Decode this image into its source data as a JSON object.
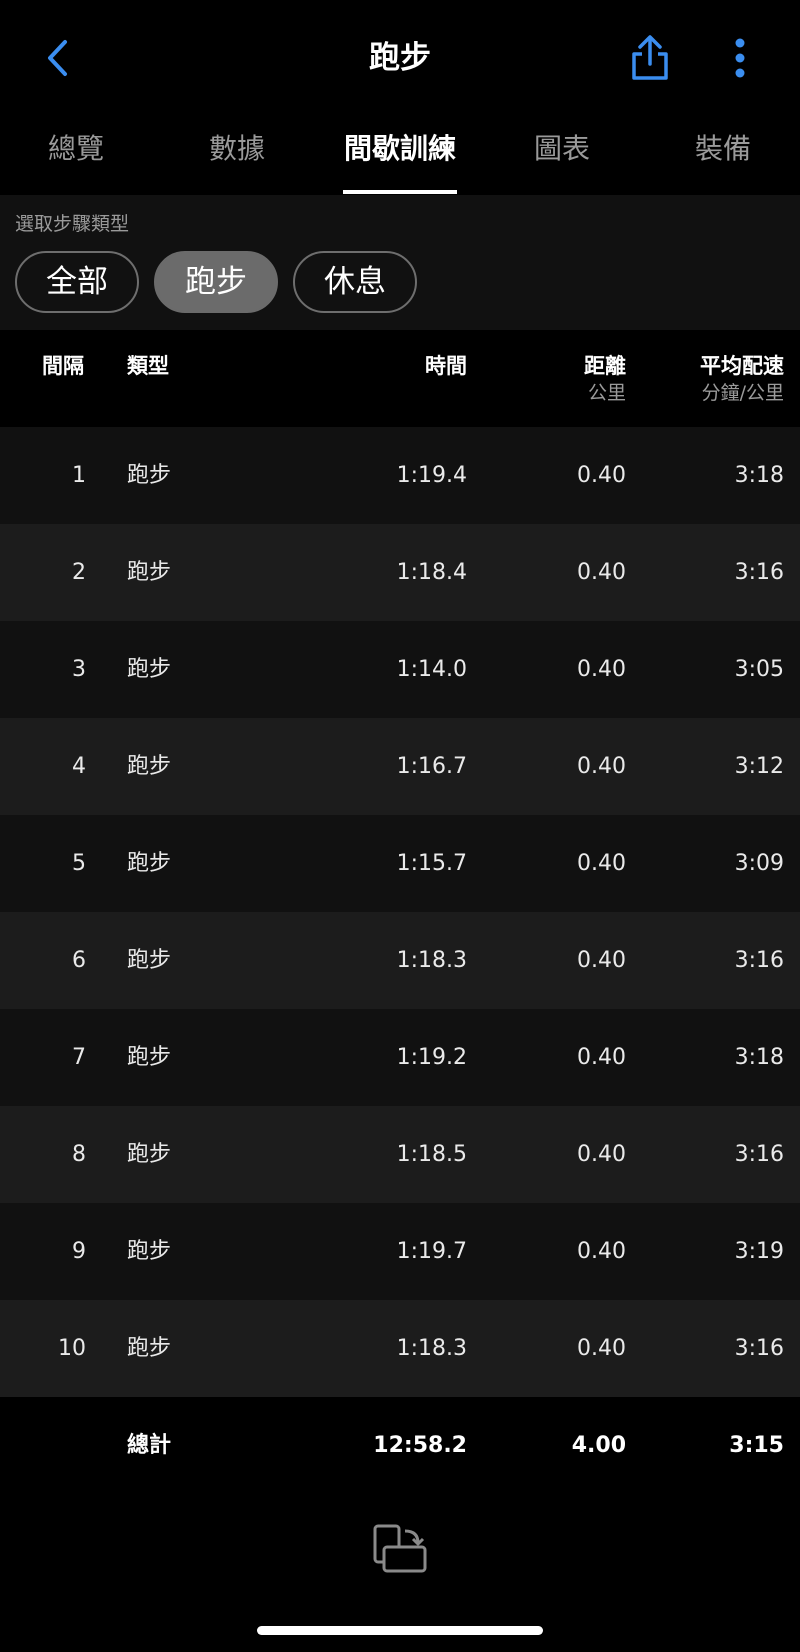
{
  "header": {
    "title": "跑步"
  },
  "tabs": [
    {
      "label": "總覽"
    },
    {
      "label": "數據"
    },
    {
      "label": "間歇訓練"
    },
    {
      "label": "圖表"
    },
    {
      "label": "裝備"
    }
  ],
  "active_tab": "間歇訓練",
  "filter": {
    "label": "選取步驟類型",
    "chips": [
      {
        "label": "全部"
      },
      {
        "label": "跑步"
      },
      {
        "label": "休息"
      }
    ],
    "selected": "跑步"
  },
  "table": {
    "headers": {
      "interval": "間隔",
      "type": "類型",
      "time": "時間",
      "distance": "距離",
      "distance_unit": "公里",
      "pace": "平均配速",
      "pace_unit": "分鐘/公里"
    },
    "rows": [
      {
        "idx": "1",
        "type": "跑步",
        "time": "1:19.4",
        "dist": "0.40",
        "pace": "3:18"
      },
      {
        "idx": "2",
        "type": "跑步",
        "time": "1:18.4",
        "dist": "0.40",
        "pace": "3:16"
      },
      {
        "idx": "3",
        "type": "跑步",
        "time": "1:14.0",
        "dist": "0.40",
        "pace": "3:05"
      },
      {
        "idx": "4",
        "type": "跑步",
        "time": "1:16.7",
        "dist": "0.40",
        "pace": "3:12"
      },
      {
        "idx": "5",
        "type": "跑步",
        "time": "1:15.7",
        "dist": "0.40",
        "pace": "3:09"
      },
      {
        "idx": "6",
        "type": "跑步",
        "time": "1:18.3",
        "dist": "0.40",
        "pace": "3:16"
      },
      {
        "idx": "7",
        "type": "跑步",
        "time": "1:19.2",
        "dist": "0.40",
        "pace": "3:18"
      },
      {
        "idx": "8",
        "type": "跑步",
        "time": "1:18.5",
        "dist": "0.40",
        "pace": "3:16"
      },
      {
        "idx": "9",
        "type": "跑步",
        "time": "1:19.7",
        "dist": "0.40",
        "pace": "3:19"
      },
      {
        "idx": "10",
        "type": "跑步",
        "time": "1:18.3",
        "dist": "0.40",
        "pace": "3:16"
      }
    ],
    "total": {
      "label": "總計",
      "time": "12:58.2",
      "dist": "4.00",
      "pace": "3:15"
    }
  },
  "icons": {
    "back": "chevron-left-icon",
    "share": "share-icon",
    "more": "more-vertical-icon",
    "rotate": "rotate-screen-icon"
  },
  "colors": {
    "accent": "#3b8ef0",
    "background": "#000000",
    "row_odd": "#111111",
    "row_even": "#1c1c1c"
  }
}
